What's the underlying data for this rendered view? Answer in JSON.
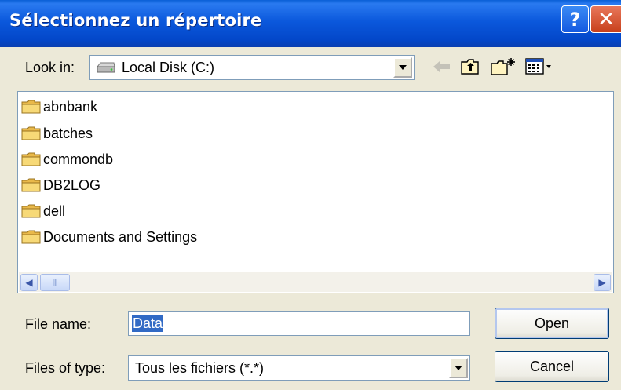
{
  "window": {
    "title": "Sélectionnez un répertoire",
    "help_label": "?",
    "close_label": "✕"
  },
  "lookin": {
    "label": "Look in:",
    "value": "Local Disk (C:)",
    "drive_icon": "hard-drive-icon"
  },
  "toolbar": {
    "back_icon": "back-arrow-icon",
    "up_icon": "up-folder-icon",
    "new_folder_icon": "new-folder-icon",
    "views_icon": "views-menu-icon"
  },
  "files": [
    {
      "name": "abnbank"
    },
    {
      "name": "batches"
    },
    {
      "name": "commondb"
    },
    {
      "name": "DB2LOG"
    },
    {
      "name": "dell"
    },
    {
      "name": "Documents and Settings"
    }
  ],
  "filename": {
    "label": "File name:",
    "value": "Data"
  },
  "filetype": {
    "label": "Files of type:",
    "value": "Tous les fichiers (*.*)"
  },
  "buttons": {
    "open": "Open",
    "cancel": "Cancel"
  },
  "colors": {
    "titlebar": "#0b58dc",
    "dialog_bg": "#ece9d8",
    "selection": "#316ac5",
    "folder": "#f2c95a"
  }
}
